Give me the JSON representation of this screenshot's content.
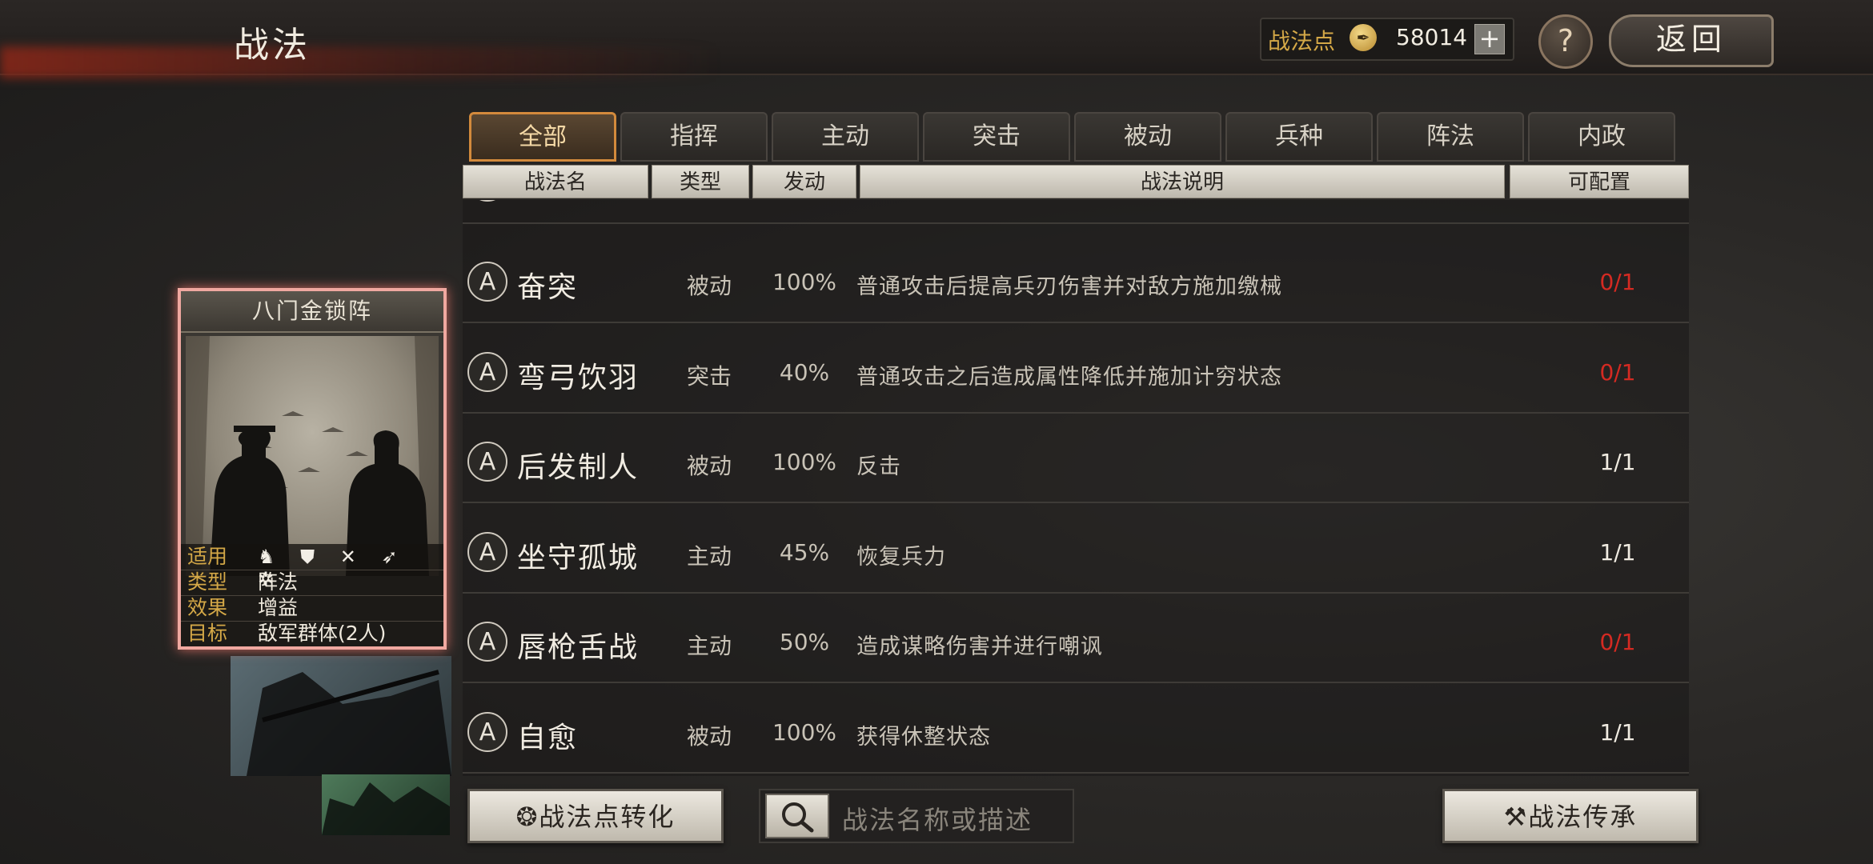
{
  "header": {
    "title": "战法",
    "points_label": "战法点",
    "points_value": "58014",
    "plus": "+",
    "help": "?",
    "back": "返回"
  },
  "tabs": [
    "全部",
    "指挥",
    "主动",
    "突击",
    "被动",
    "兵种",
    "阵法",
    "内政"
  ],
  "columns": {
    "name": "战法名",
    "type": "类型",
    "rate": "发动",
    "desc": "战法说明",
    "cap": "可配置"
  },
  "skills": [
    {
      "grade": "A",
      "name": "奋突",
      "type": "被动",
      "rate": "100%",
      "desc": "普通攻击后提高兵刃伤害并对敌方施加缴械",
      "cap": "0/1",
      "cap_color": "#d42a22"
    },
    {
      "grade": "A",
      "name": "弯弓饮羽",
      "type": "突击",
      "rate": "40%",
      "desc": "普通攻击之后造成属性降低并施加计穷状态",
      "cap": "0/1",
      "cap_color": "#d42a22"
    },
    {
      "grade": "A",
      "name": "后发制人",
      "type": "被动",
      "rate": "100%",
      "desc": "反击",
      "cap": "1/1",
      "cap_color": "#f0ebe1"
    },
    {
      "grade": "A",
      "name": "坐守孤城",
      "type": "主动",
      "rate": "45%",
      "desc": "恢复兵力",
      "cap": "1/1",
      "cap_color": "#f0ebe1"
    },
    {
      "grade": "A",
      "name": "唇枪舌战",
      "type": "主动",
      "rate": "50%",
      "desc": "造成谋略伤害并进行嘲讽",
      "cap": "0/1",
      "cap_color": "#d42a22"
    },
    {
      "grade": "A",
      "name": "自愈",
      "type": "被动",
      "rate": "100%",
      "desc": "获得休整状态",
      "cap": "1/1",
      "cap_color": "#f0ebe1"
    }
  ],
  "card": {
    "title": "八门金锁阵",
    "attrs": [
      {
        "key": "适用",
        "val": "♞ ⛊ ✕ ➶ ✲"
      },
      {
        "key": "类型",
        "val": "阵法"
      },
      {
        "key": "效果",
        "val": "增益"
      },
      {
        "key": "目标",
        "val": "敌军群体(2人)"
      }
    ]
  },
  "footer": {
    "convert_label": "战法点转化",
    "search_placeholder": "战法名称或描述",
    "inherit_label": "战法传承"
  }
}
